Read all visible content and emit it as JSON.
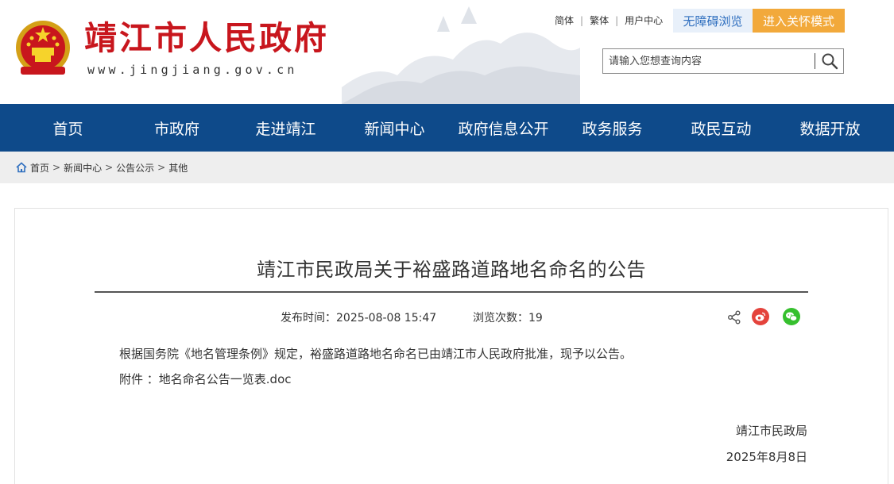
{
  "header": {
    "site_title": "靖江市人民政府",
    "site_url": "www.jingjiang.gov.cn",
    "top_links": [
      "简体",
      "繁体",
      "用户中心"
    ],
    "accessibility_button": "无障碍浏览",
    "elder_mode_button": "进入关怀模式",
    "search": {
      "placeholder": "请输入您想查询内容"
    }
  },
  "nav": {
    "items": [
      "首页",
      "市政府",
      "走进靖江",
      "新闻中心",
      "政府信息公开",
      "政务服务",
      "政民互动",
      "数据开放"
    ]
  },
  "breadcrumb": {
    "items": [
      "首页",
      "新闻中心",
      "公告公示",
      "其他"
    ],
    "separator": ">"
  },
  "article": {
    "title": "靖江市民政局关于裕盛路道路地名命名的公告",
    "publish_time": "发布时间：2025-08-08 15:47",
    "views": "浏览次数：19",
    "body": "根据国务院《地名管理条例》规定，裕盛路道路地名命名已由靖江市人民政府批准，现予以公告。",
    "attachment_label": "附件 ：",
    "attachment_name": "地名命名公告一览表.doc",
    "signature_org": "靖江市民政局",
    "signature_date": "2025年8月8日"
  },
  "colors": {
    "brand_red": "#c8161d",
    "nav_blue": "#0e4a8a",
    "elder_orange": "#f2a93b",
    "weibo_red": "#e4433c",
    "wechat_green": "#36c02e"
  },
  "icons": [
    "national-emblem-icon",
    "search-icon",
    "home-icon",
    "share-icon",
    "weibo-icon",
    "wechat-icon"
  ]
}
